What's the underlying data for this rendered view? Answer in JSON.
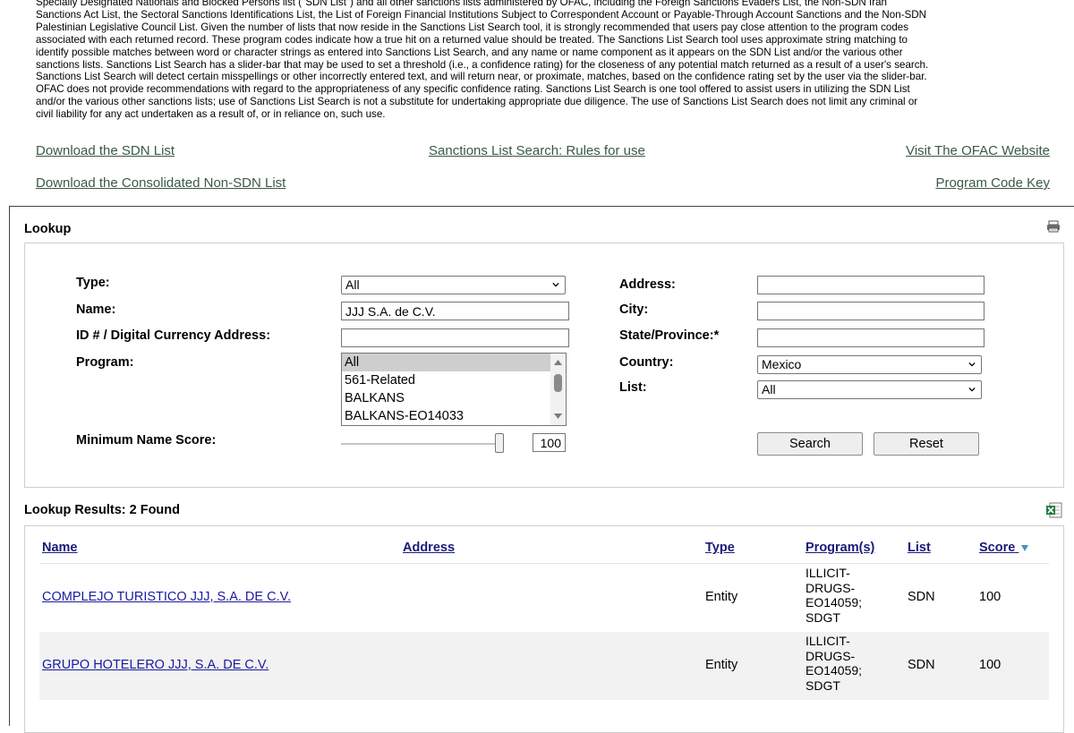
{
  "intro_lines": [
    "Specially Designated Nationals and Blocked Persons list (\"SDN List\") and all other sanctions lists administered by OFAC, including the Foreign Sanctions Evaders List, the Non-SDN Iran",
    "Sanctions Act List, the Sectoral Sanctions Identifications List, the List of Foreign Financial Institutions Subject to Correspondent Account or Payable-Through Account Sanctions and the Non-SDN",
    "Palestinian Legislative Council List. Given the number of lists that now reside in the Sanctions List Search tool, it is strongly recommended that users pay close attention to the program codes",
    "associated with each returned record. These program codes indicate how a true hit on a returned value should be treated. The Sanctions List Search tool uses approximate string matching to",
    "identify possible matches between word or character strings as entered into Sanctions List Search, and any name or name component as it appears on the SDN List and/or the various other",
    "sanctions lists. Sanctions List Search has a slider-bar that may be used to set a threshold (i.e., a confidence rating) for the closeness of any potential match returned as a result of a user's search.",
    "Sanctions List Search will detect certain misspellings or other incorrectly entered text, and will return near, or proximate, matches, based on the confidence rating set by the user via the slider-bar.",
    "OFAC does not provide recommendations with regard to the appropriateness of any specific confidence rating. Sanctions List Search is one tool offered to assist users in utilizing the SDN List",
    "and/or the various other sanctions lists; use of Sanctions List Search is not a substitute for undertaking appropriate due diligence. The use of Sanctions List Search does not limit any criminal or",
    "civil liability for any act undertaken as a result of, or in reliance on, such use."
  ],
  "links": {
    "download_sdn": "Download the SDN List",
    "rules": "Sanctions List Search: Rules for use",
    "visit_ofac": "Visit The OFAC Website",
    "download_consolidated": "Download the Consolidated Non-SDN List",
    "program_key": "Program Code Key"
  },
  "lookup": {
    "title": "Lookup",
    "labels": {
      "type": "Type:",
      "name": "Name:",
      "id": "ID # / Digital Currency Address:",
      "program": "Program:",
      "min_score": "Minimum Name Score:",
      "address": "Address:",
      "city": "City:",
      "state": "State/Province:*",
      "country": "Country:",
      "list": "List:"
    },
    "values": {
      "type": "All",
      "name": "JJJ S.A. de C.V.",
      "id": "",
      "address": "",
      "city": "",
      "state": "",
      "country": "Mexico",
      "list": "All",
      "min_score": "100"
    },
    "program_options": [
      "All",
      "561-Related",
      "BALKANS",
      "BALKANS-EO14033"
    ],
    "program_selected": "All",
    "buttons": {
      "search": "Search",
      "reset": "Reset"
    }
  },
  "results": {
    "title": "Lookup Results: 2 Found",
    "columns": {
      "name": "Name",
      "address": "Address",
      "type": "Type",
      "programs": "Program(s)",
      "list": "List",
      "score": "Score"
    },
    "rows": [
      {
        "name": "COMPLEJO TURISTICO JJJ, S.A. DE C.V.",
        "address": "",
        "type": "Entity",
        "programs": [
          "ILLICIT-",
          "DRUGS-",
          "EO14059;",
          "SDGT"
        ],
        "list": "SDN",
        "score": "100"
      },
      {
        "name": "GRUPO HOTELERO JJJ, S.A. DE C.V.",
        "address": "",
        "type": "Entity",
        "programs": [
          "ILLICIT-",
          "DRUGS-",
          "EO14059;",
          "SDGT"
        ],
        "list": "SDN",
        "score": "100"
      }
    ]
  },
  "icons": {
    "print": "printer-icon",
    "export": "excel-export-icon",
    "sort": "sort-down-icon"
  },
  "colors": {
    "link": "#1a1aa0",
    "top_link": "#3a5a45",
    "header_link": "#1a1a7a",
    "sort_arrow": "#4a90c0",
    "row_alt": "#f2f2f2"
  }
}
